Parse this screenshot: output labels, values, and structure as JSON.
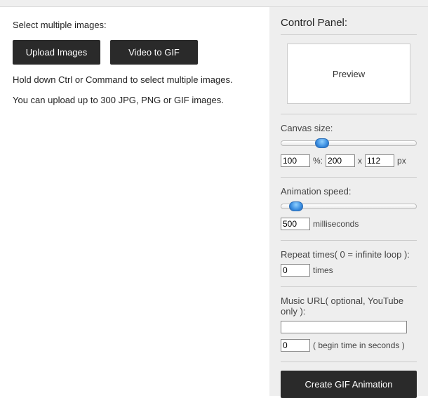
{
  "left": {
    "select_label": "Select multiple images:",
    "upload_btn": "Upload Images",
    "video_btn": "Video to GIF",
    "hint1": "Hold down Ctrl or Command to select multiple images.",
    "hint2": "You can upload up to 300 JPG, PNG or GIF images."
  },
  "panel": {
    "title": "Control Panel:",
    "preview": "Preview",
    "canvas": {
      "label": "Canvas size:",
      "percent": "100",
      "percent_unit": "%:",
      "width": "200",
      "x": "x",
      "height": "112",
      "px": "px",
      "slider_pos_pct": 25
    },
    "speed": {
      "label": "Animation speed:",
      "value": "500",
      "unit": "milliseconds",
      "slider_pos_pct": 6
    },
    "repeat": {
      "label": "Repeat times( 0 = infinite loop ):",
      "value": "0",
      "unit": "times"
    },
    "music": {
      "label": "Music URL( optional, YouTube only ):",
      "url": "",
      "begin": "0",
      "begin_unit": "( begin time in seconds )"
    },
    "create_btn": "Create GIF Animation"
  }
}
